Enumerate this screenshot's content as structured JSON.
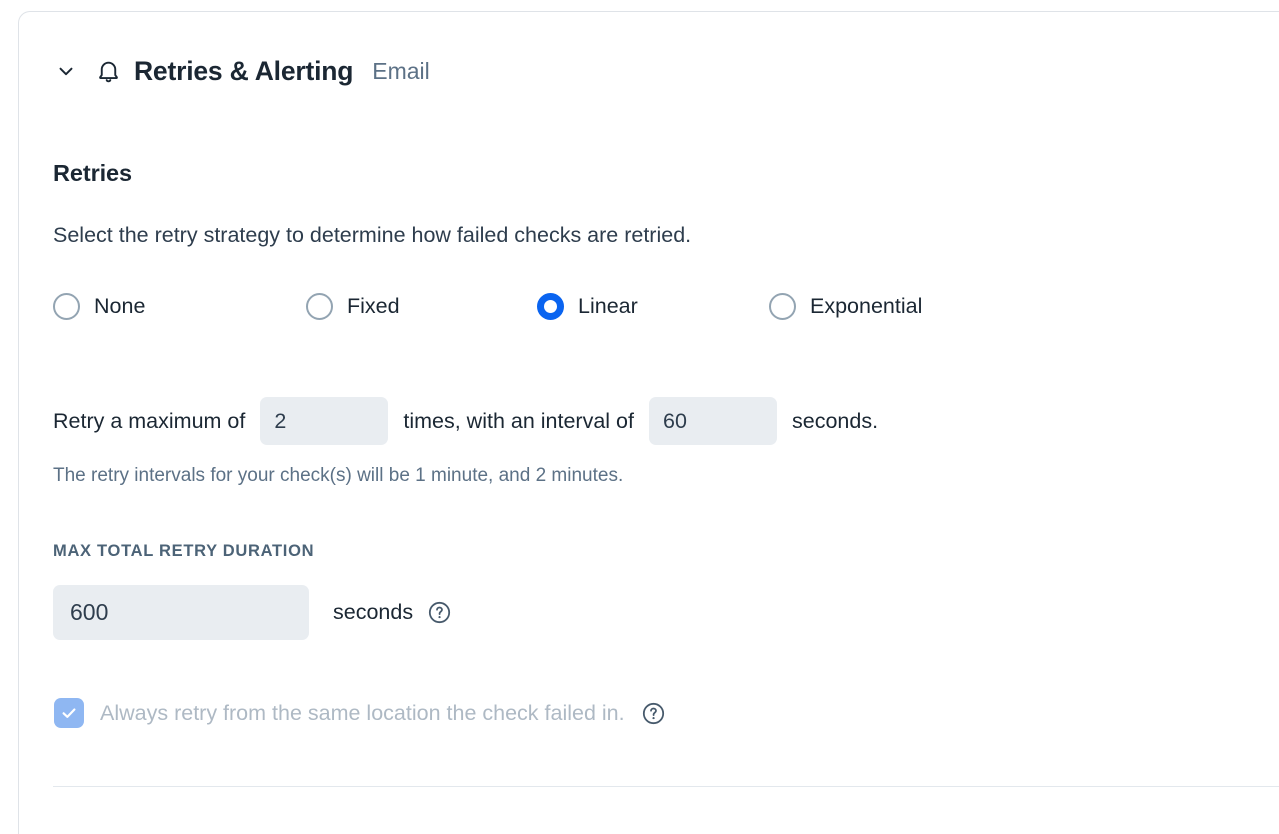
{
  "header": {
    "title": "Retries & Alerting",
    "subtitle": "Email",
    "chevron_icon": "chevron-down-icon",
    "bell_icon": "bell-icon"
  },
  "retries": {
    "section_title": "Retries",
    "section_description": "Select the retry strategy to determine how failed checks are retried.",
    "strategies": [
      {
        "label": "None",
        "selected": false
      },
      {
        "label": "Fixed",
        "selected": false
      },
      {
        "label": "Linear",
        "selected": true
      },
      {
        "label": "Exponential",
        "selected": false
      }
    ],
    "sentence": {
      "prefix": "Retry a maximum of",
      "max_retries_value": "2",
      "middle": "times, with an interval of",
      "interval_value": "60",
      "suffix": "seconds."
    },
    "interval_note": "The retry intervals for your check(s) will be 1 minute, and 2 minutes.",
    "max_total_duration": {
      "label": "MAX TOTAL RETRY DURATION",
      "value": "600",
      "unit": "seconds",
      "help_icon": "question-mark-circle-icon"
    },
    "same_location": {
      "label": "Always retry from the same location the check failed in.",
      "checked": true,
      "help_icon": "question-mark-circle-icon"
    }
  },
  "colors": {
    "accent_blue": "#0a64f0",
    "checkbox_blue": "#8fb7f2",
    "input_bg": "#e9edf1",
    "muted_text": "#5c7186",
    "disabled_text": "#aeb9c4",
    "heading_text": "#1b2733",
    "border": "#dfe3e8"
  }
}
